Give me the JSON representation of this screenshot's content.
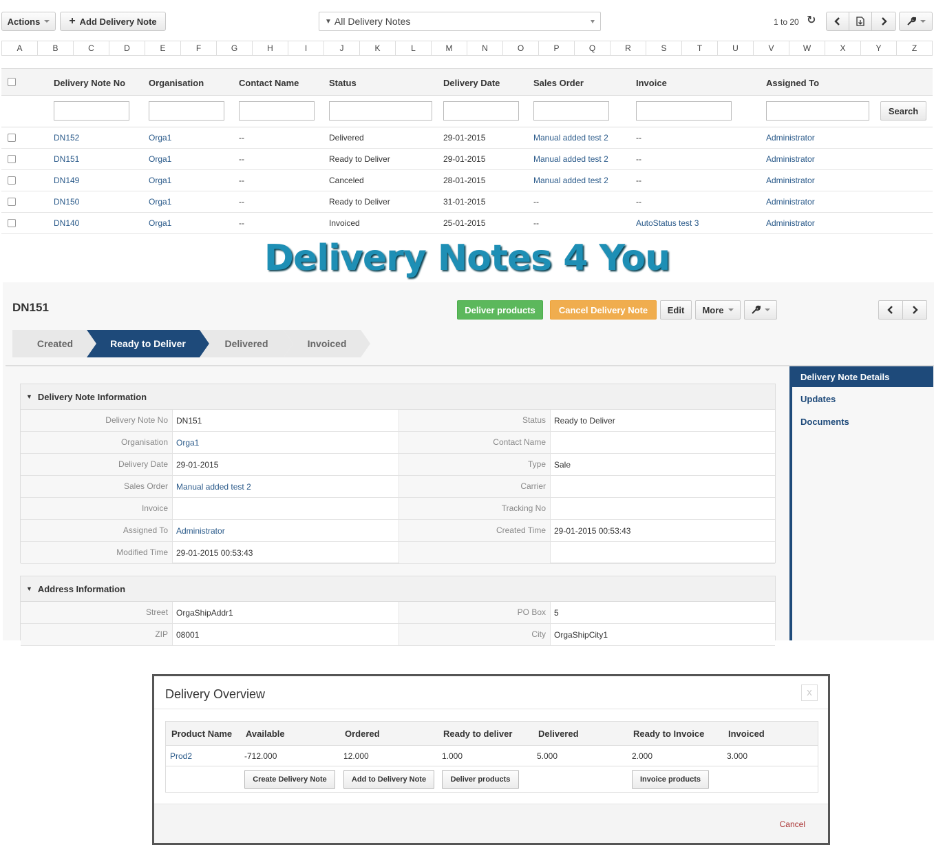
{
  "toolbar": {
    "actions_label": "Actions",
    "add_label": "Add Delivery Note",
    "filter_label": "All Delivery Notes",
    "pager_text": "1 to 20"
  },
  "alphabet": [
    "A",
    "B",
    "C",
    "D",
    "E",
    "F",
    "G",
    "H",
    "I",
    "J",
    "K",
    "L",
    "M",
    "N",
    "O",
    "P",
    "Q",
    "R",
    "S",
    "T",
    "U",
    "V",
    "W",
    "X",
    "Y",
    "Z"
  ],
  "list": {
    "headers": {
      "no": "Delivery Note No",
      "org": "Organisation",
      "contact": "Contact Name",
      "status": "Status",
      "date": "Delivery Date",
      "order": "Sales Order",
      "invoice": "Invoice",
      "assigned": "Assigned To"
    },
    "search_label": "Search",
    "rows": [
      {
        "no": "DN152",
        "org": "Orga1",
        "contact": "--",
        "status": "Delivered",
        "date": "29-01-2015",
        "order": "Manual added test 2",
        "invoice": "--",
        "assigned": "Administrator"
      },
      {
        "no": "DN151",
        "org": "Orga1",
        "contact": "--",
        "status": "Ready to Deliver",
        "date": "29-01-2015",
        "order": "Manual added test 2",
        "invoice": "--",
        "assigned": "Administrator"
      },
      {
        "no": "DN149",
        "org": "Orga1",
        "contact": "--",
        "status": "Canceled",
        "date": "28-01-2015",
        "order": "Manual added test 2",
        "invoice": "--",
        "assigned": "Administrator"
      },
      {
        "no": "DN150",
        "org": "Orga1",
        "contact": "--",
        "status": "Ready to Deliver",
        "date": "31-01-2015",
        "order": "--",
        "invoice": "--",
        "assigned": "Administrator"
      },
      {
        "no": "DN140",
        "org": "Orga1",
        "contact": "--",
        "status": "Invoiced",
        "date": "25-01-2015",
        "order": "--",
        "invoice": "AutoStatus test 3",
        "assigned": "Administrator"
      }
    ]
  },
  "logo_text": "Delivery Notes 4 You",
  "detail": {
    "title": "DN151",
    "buttons": {
      "deliver": "Deliver products",
      "cancel": "Cancel Delivery Note",
      "edit": "Edit",
      "more": "More"
    },
    "steps": [
      "Created",
      "Ready to Deliver",
      "Delivered",
      "Invoiced"
    ],
    "active_step": "Ready to Deliver",
    "info_block": {
      "title": "Delivery Note Information",
      "rows": [
        {
          "l1": "Delivery Note No",
          "v1": "DN151",
          "l2": "Status",
          "v2": "Ready to Deliver"
        },
        {
          "l1": "Organisation",
          "v1": "Orga1",
          "l2": "Contact Name",
          "v2": ""
        },
        {
          "l1": "Delivery Date",
          "v1": "29-01-2015",
          "l2": "Type",
          "v2": "Sale"
        },
        {
          "l1": "Sales Order",
          "v1": "Manual added test 2",
          "l2": "Carrier",
          "v2": ""
        },
        {
          "l1": "Invoice",
          "v1": "",
          "l2": "Tracking No",
          "v2": ""
        },
        {
          "l1": "Assigned To",
          "v1": "Administrator",
          "l2": "Created Time",
          "v2": "29-01-2015 00:53:43"
        },
        {
          "l1": "Modified Time",
          "v1": "29-01-2015 00:53:43",
          "l2": "",
          "v2": ""
        }
      ]
    },
    "address_block": {
      "title": "Address Information",
      "rows": [
        {
          "l1": "Street",
          "v1": "OrgaShipAddr1",
          "l2": "PO Box",
          "v2": "5"
        },
        {
          "l1": "ZIP",
          "v1": "08001",
          "l2": "City",
          "v2": "OrgaShipCity1"
        }
      ]
    },
    "sidenav": [
      "Delivery Note Details",
      "Updates",
      "Documents"
    ]
  },
  "modal": {
    "title": "Delivery Overview",
    "close": "x",
    "headers": [
      "Product Name",
      "Available",
      "Ordered",
      "Ready to deliver",
      "Delivered",
      "Ready to Invoice",
      "Invoiced"
    ],
    "row": [
      "Prod2",
      "-712.000",
      "12.000",
      "1.000",
      "5.000",
      "2.000",
      "3.000"
    ],
    "buttons": [
      "Create Delivery Note",
      "Add to Delivery Note",
      "Deliver products",
      "Invoice products"
    ],
    "cancel": "Cancel"
  },
  "colors": {
    "primary": "#1e4a7a",
    "success": "#5cb85c",
    "warning": "#f0ad4e",
    "link": "#2a5a8a",
    "logo": "#1e8fb5"
  },
  "icons": [
    "caret-down-icon",
    "plus-icon",
    "filter-icon",
    "refresh-icon",
    "chevron-left-icon",
    "chevron-right-icon",
    "export-icon",
    "wrench-icon",
    "collapse-icon",
    "close-icon"
  ]
}
